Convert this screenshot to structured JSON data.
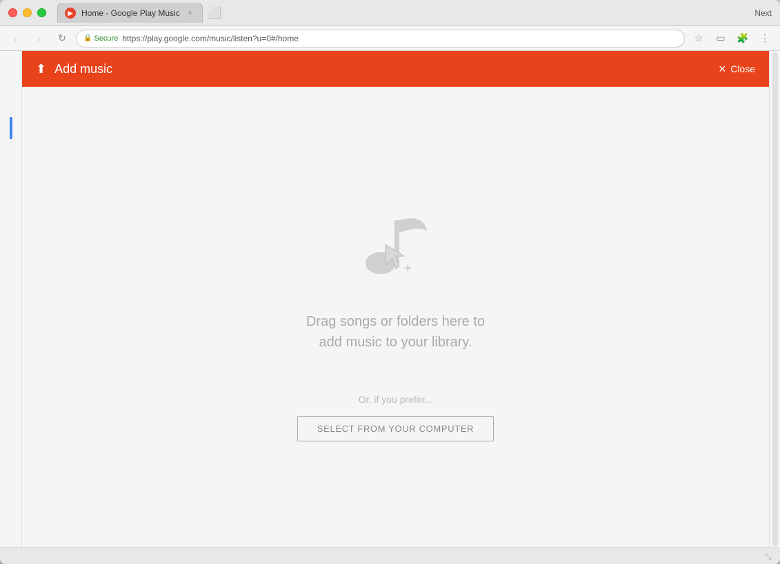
{
  "browser": {
    "title_next": "Next",
    "tab": {
      "label": "Home - Google Play Music",
      "close_label": "×"
    },
    "nav": {
      "back_label": "‹",
      "forward_label": "›",
      "refresh_label": "↻"
    },
    "address": {
      "secure_label": "Secure",
      "url": "https://play.google.com/music/listen?u=0#/home"
    }
  },
  "modal": {
    "header": {
      "title": "Add music",
      "close_label": "Close",
      "upload_icon": "▲"
    },
    "body": {
      "drag_line1": "Drag songs or folders here to",
      "drag_line2": "add music to your library.",
      "or_text": "Or, if you prefer...",
      "select_button_label": "SELECT FROM YOUR COMPUTER"
    }
  },
  "icons": {
    "upload": "▲",
    "close_x": "✕",
    "lock": "🔒",
    "star": "☆",
    "cast": "▭",
    "menu": "⋮",
    "refresh": "↻",
    "back": "‹",
    "forward": "›"
  }
}
